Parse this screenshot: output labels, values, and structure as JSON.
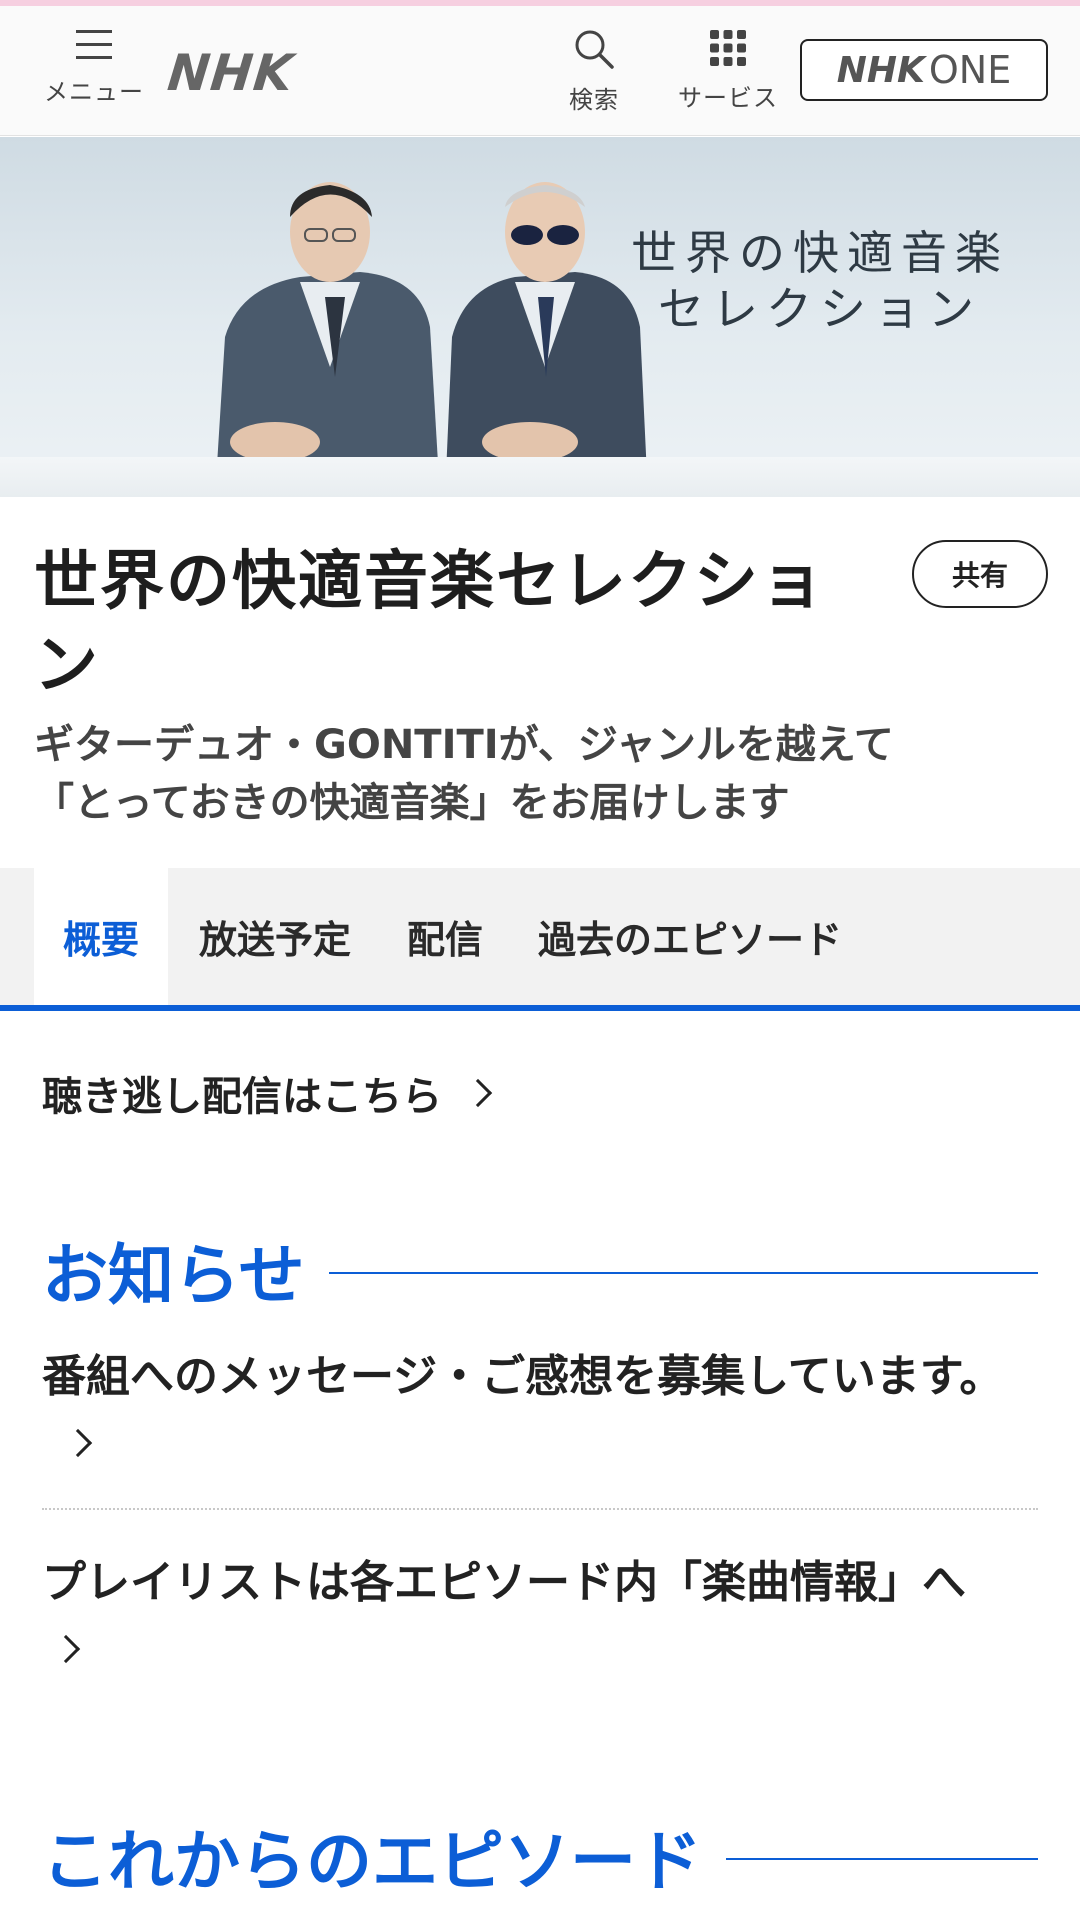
{
  "header": {
    "menu_label": "メニュー",
    "logo": "NHK",
    "search_label": "検索",
    "services_label": "サービス",
    "one_button": {
      "nhk": "NHK",
      "one": "ONE"
    }
  },
  "hero": {
    "title_line1": "世界の快適音楽",
    "title_line2": "セレクション"
  },
  "program": {
    "title": "世界の快適音楽セレクション",
    "share_label": "共有",
    "description": "ギターデュオ・GONTITIが、ジャンルを越えて「とっておきの快適音楽」をお届けします"
  },
  "tabs": [
    {
      "label": "概要",
      "active": true
    },
    {
      "label": "放送予定",
      "active": false
    },
    {
      "label": "配信",
      "active": false
    },
    {
      "label": "過去のエピソード",
      "active": false
    }
  ],
  "missed_link": "聴き逃し配信はこちら",
  "notices": {
    "heading": "お知らせ",
    "items": [
      "番組へのメッセージ・ご感想を募集しています。",
      "プレイリストは各エピソード内「楽曲情報」へ"
    ]
  },
  "upcoming": {
    "heading": "これからのエピソード"
  },
  "colors": {
    "accent": "#0c5ed6",
    "header_bg": "#fafafa",
    "top_stripe": "#f6cfe0",
    "tabs_bg": "#f2f2f2"
  }
}
